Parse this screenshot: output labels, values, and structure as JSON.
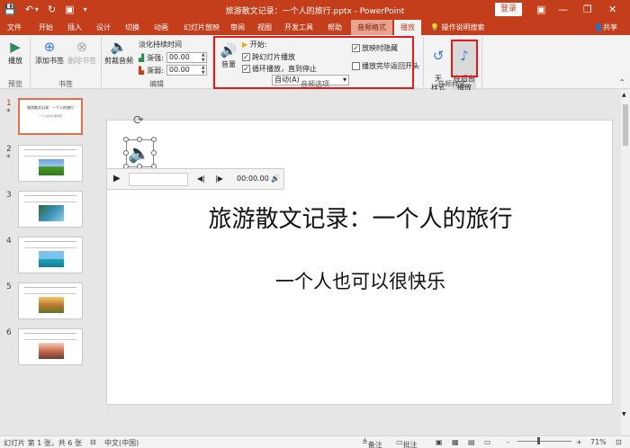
{
  "window": {
    "title": "旅游散文记录：一个人的旅行.pptx  -  PowerPoint",
    "login_label": "登录",
    "minimize": "—",
    "restore": "❐",
    "close": "✕"
  },
  "qat": {
    "save": "💾",
    "undo": "↶",
    "undo_drop": "▾",
    "redo": "↻",
    "present": "▣",
    "more": "▾"
  },
  "tabs": [
    {
      "label": "文件"
    },
    {
      "label": "开始"
    },
    {
      "label": "插入"
    },
    {
      "label": "设计"
    },
    {
      "label": "切换"
    },
    {
      "label": "动画"
    },
    {
      "label": "幻灯片放映"
    },
    {
      "label": "审阅"
    },
    {
      "label": "视图"
    },
    {
      "label": "开发工具"
    },
    {
      "label": "帮助"
    },
    {
      "label": "音频格式"
    },
    {
      "label": "播放"
    }
  ],
  "tell_me": "操作说明搜索",
  "share": "共享",
  "ribbon": {
    "preview": {
      "play_label": "播放",
      "group": "预览"
    },
    "bookmarks": {
      "add_label": "添加书签",
      "remove_label": "删除书签",
      "group": "书签"
    },
    "editing": {
      "trim_label": "剪裁音频",
      "fade_title": "淡化持续时间",
      "fade_in_label": "渐强:",
      "fade_in_value": "00.00",
      "fade_out_label": "渐弱:",
      "fade_out_value": "00.00",
      "group": "编辑"
    },
    "audio_options": {
      "volume_label": "音量",
      "start_label": "开始:",
      "start_value": "自动(A)",
      "cross_slides": "跨幻灯片播放",
      "loop_until_stop": "循环播放，直到停止",
      "hide_during_show": "放映时隐藏",
      "rewind_after": "播放完毕返回开头",
      "group": "音频选项"
    },
    "audio_styles": {
      "no_style_label": "无\n样式",
      "background_label": "在后台\n播放",
      "group": "音频样式"
    }
  },
  "slides": [
    {
      "num": "1",
      "star": "*",
      "title": "旅游散文记录：一个人的旅行",
      "subtitle": "一个人也可以很快乐"
    },
    {
      "num": "2",
      "star": "*"
    },
    {
      "num": "3",
      "star": ""
    },
    {
      "num": "4",
      "star": ""
    },
    {
      "num": "5",
      "star": ""
    },
    {
      "num": "6",
      "star": ""
    }
  ],
  "current_slide": {
    "title": "旅游散文记录：一个人的旅行",
    "subtitle": "一个人也可以很快乐"
  },
  "player": {
    "play": "▶",
    "back": "◀|",
    "forward": "|▶",
    "time": "00:00.00",
    "volume": "🔊"
  },
  "status": {
    "slide_count": "幻灯片 第 1 张，共 6 张",
    "language": "中文(中国)",
    "notes": "备注",
    "comments": "批注",
    "zoom_minus": "-",
    "zoom_plus": "+",
    "zoom": "71%"
  },
  "colors": {
    "accent": "#c43e1c",
    "highlight": "#e21b1b"
  }
}
